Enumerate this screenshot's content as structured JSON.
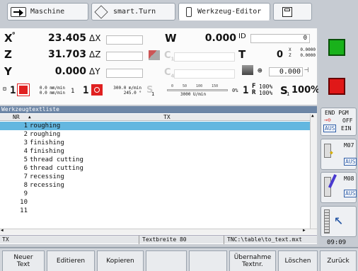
{
  "tabs": [
    {
      "label": "Maschine",
      "icon": "machine-icon"
    },
    {
      "label": "smart.Turn",
      "icon": "smart-turn-icon"
    },
    {
      "label": "Werkzeug-Editor",
      "icon": "tool-editor-icon"
    },
    {
      "label": "",
      "icon": "save-icon"
    }
  ],
  "positions": {
    "x": {
      "axis": "X",
      "value": "23.405",
      "delta": "ΔX"
    },
    "z": {
      "axis": "Z",
      "value": "31.703",
      "delta": "ΔZ"
    },
    "y": {
      "axis": "Y",
      "value": "0.000",
      "delta": "ΔY"
    },
    "w": {
      "axis": "W",
      "value": "0.000",
      "id_label": "ID",
      "id_value": "0"
    },
    "t": {
      "label": "T",
      "value": "0",
      "x_label": "X",
      "x_value": "0.0000",
      "z_label": "Z",
      "z_value": "0.0000"
    },
    "c1": "C",
    "c1_sub": "1",
    "c4": "C",
    "c4_sub": "4",
    "spindle_angle": "0.000"
  },
  "feed": {
    "slot1": "1",
    "feed1_a": "0.0 mm/min",
    "feed1_b": "0.0 mm/min",
    "num1": "1",
    "num2": "1",
    "feed2_a": "300.0 m/min",
    "feed2_b": "245.0 °",
    "s_label": "S",
    "s_sub": "1",
    "scale_ticks": "0 50 100 150",
    "rpm": "3000 U/min",
    "pct": "0%",
    "f_label": "F",
    "f_pct": "100%",
    "r_label": "R",
    "r_pct": "100%",
    "s1_label": "S",
    "s1_sub": "1",
    "s1_pct": "100%"
  },
  "table": {
    "title": "Werkzeugtextliste",
    "col_nr": "NR",
    "col_tx": "TX",
    "rows": [
      {
        "nr": "1",
        "tx": "roughing",
        "selected": true
      },
      {
        "nr": "2",
        "tx": "roughing"
      },
      {
        "nr": "3",
        "tx": "finishing"
      },
      {
        "nr": "4",
        "tx": "finishing"
      },
      {
        "nr": "5",
        "tx": "thread cutting"
      },
      {
        "nr": "6",
        "tx": "thread cutting"
      },
      {
        "nr": "7",
        "tx": "recessing"
      },
      {
        "nr": "8",
        "tx": "recessing"
      },
      {
        "nr": "9",
        "tx": ""
      },
      {
        "nr": "10",
        "tx": ""
      },
      {
        "nr": "11",
        "tx": ""
      }
    ],
    "status_left": "TX",
    "status_mid": "Textbreite 80",
    "status_right": "TNC:\\table\\to_text.mxt"
  },
  "right_panel": {
    "end_pgm": "END PGM",
    "off": "OFF",
    "aus1": "AUS",
    "ein": "EIN",
    "m07": "M07",
    "aus2": "AUS",
    "m08": "M08",
    "aus3": "AUS",
    "clock": "09:09"
  },
  "softkeys": [
    {
      "label": "Neuer\nText"
    },
    {
      "label": "Editieren"
    },
    {
      "label": "Kopieren"
    },
    {
      "label": ""
    },
    {
      "label": ""
    },
    {
      "label": "Übernahme\nTextnr."
    },
    {
      "label": "Löschen"
    },
    {
      "label": "Zurück"
    }
  ],
  "colors": {
    "accent": "#63b7e0",
    "title_bar": "#6d86a6",
    "green": "#19b21b",
    "red": "#e01818"
  }
}
